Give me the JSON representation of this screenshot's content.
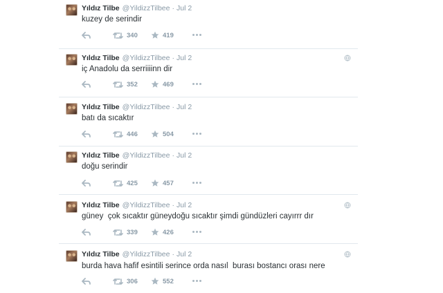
{
  "tweets": [
    {
      "name": "Yıldız Tilbe",
      "handle": "@YildizzTilbee",
      "sep": "·",
      "time": "Jul 2",
      "text": "kuzey de serindir",
      "retweets": "340",
      "favorites": "419",
      "globe": false
    },
    {
      "name": "Yıldız Tilbe",
      "handle": "@YildizzTilbee",
      "sep": "·",
      "time": "Jul 2",
      "text": "iç Anadolu da serriiiinn dir",
      "retweets": "352",
      "favorites": "469",
      "globe": true
    },
    {
      "name": "Yıldız Tilbe",
      "handle": "@YildizzTilbee",
      "sep": "·",
      "time": "Jul 2",
      "text": "batı da sıcaktır",
      "retweets": "446",
      "favorites": "504",
      "globe": false
    },
    {
      "name": "Yıldız Tilbe",
      "handle": "@YildizzTilbee",
      "sep": "·",
      "time": "Jul 2",
      "text": "doğu serindir",
      "retweets": "425",
      "favorites": "457",
      "globe": false
    },
    {
      "name": "Yıldız Tilbe",
      "handle": "@YildizzTilbee",
      "sep": "·",
      "time": "Jul 2",
      "text": "güney  çok sıcaktır güneydoğu sıcaktır şimdi gündüzleri cayırrr dır",
      "retweets": "339",
      "favorites": "426",
      "globe": true
    },
    {
      "name": "Yıldız Tilbe",
      "handle": "@YildizzTilbee",
      "sep": "·",
      "time": "Jul 2",
      "text": "burda hava hafif esintili serince orda nasıl  burası bostancı orası nere",
      "retweets": "306",
      "favorites": "552",
      "globe": true
    }
  ],
  "icons": {
    "reply": "reply-icon",
    "retweet": "retweet-icon",
    "favorite": "star-icon",
    "more": "more-dots-icon",
    "globe": "globe-icon"
  },
  "colors": {
    "text": "#292f33",
    "muted": "#8899a6",
    "divider": "#e1e8ed"
  }
}
